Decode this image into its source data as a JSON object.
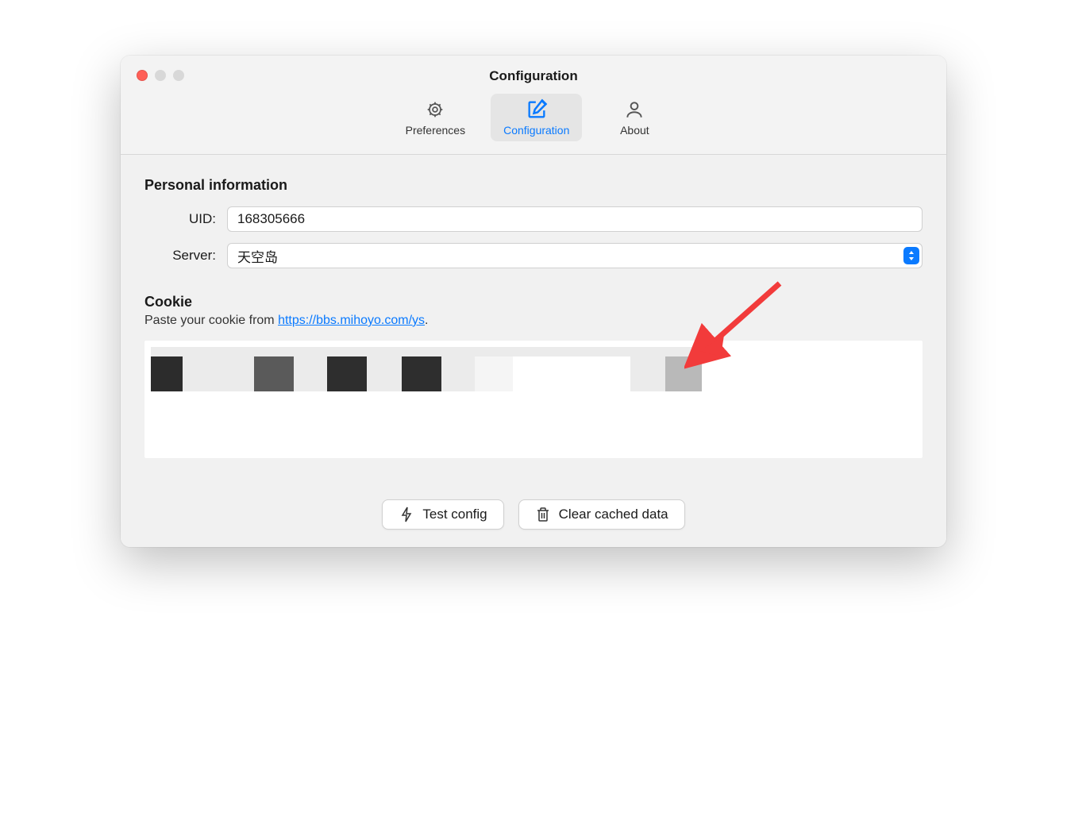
{
  "window": {
    "title": "Configuration"
  },
  "tabs": {
    "preferences": {
      "label": "Preferences"
    },
    "configuration": {
      "label": "Configuration"
    },
    "about": {
      "label": "About"
    }
  },
  "section": {
    "personal_info_heading": "Personal information",
    "uid_label": "UID:",
    "uid_value": "168305666",
    "server_label": "Server:",
    "server_value": "天空岛"
  },
  "cookie": {
    "heading": "Cookie",
    "desc_prefix": "Paste your cookie from ",
    "link_text": "https://bbs.mihoyo.com/ys",
    "desc_suffix": "."
  },
  "buttons": {
    "test_config": "Test config",
    "clear_cached": "Clear cached data"
  },
  "colors": {
    "accent": "#0a7aff",
    "arrow": "#f23b3b"
  }
}
